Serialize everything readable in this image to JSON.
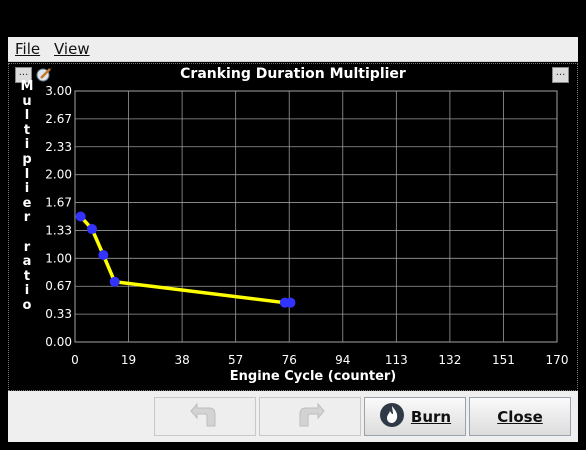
{
  "menu": {
    "file": "File",
    "view": "View"
  },
  "panel": {
    "left_button": "...",
    "right_button": "..."
  },
  "icons": {
    "left_toolbar": "edit-icon",
    "undo": "undo-icon",
    "redo": "redo-icon",
    "burn": "flame-icon"
  },
  "chart_data": {
    "type": "line",
    "title": "Cranking Duration Multiplier",
    "xlabel": "Engine Cycle (counter)",
    "ylabel_chars": [
      "M",
      "u",
      "l",
      "t",
      "i",
      "p",
      "l",
      "i",
      "e",
      "r",
      " ",
      "r",
      "a",
      "t",
      "i",
      "o"
    ],
    "xlim": [
      0,
      170
    ],
    "ylim": [
      0,
      3.0
    ],
    "x_ticks": [
      "0",
      "19",
      "38",
      "57",
      "76",
      "94",
      "113",
      "132",
      "151",
      "170"
    ],
    "y_ticks": [
      "3.00",
      "2.67",
      "2.33",
      "2.00",
      "1.67",
      "1.33",
      "1.00",
      "0.67",
      "0.33",
      "0.00"
    ],
    "grid": true,
    "line_color": "#ffff00",
    "point_color": "#3333ff",
    "series": [
      {
        "x": [
          2,
          6,
          10,
          14,
          74,
          76
        ],
        "y": [
          1.5,
          1.35,
          1.04,
          0.72,
          0.47,
          0.47
        ]
      }
    ]
  },
  "buttons": {
    "burn": "Burn",
    "close": "Close"
  }
}
